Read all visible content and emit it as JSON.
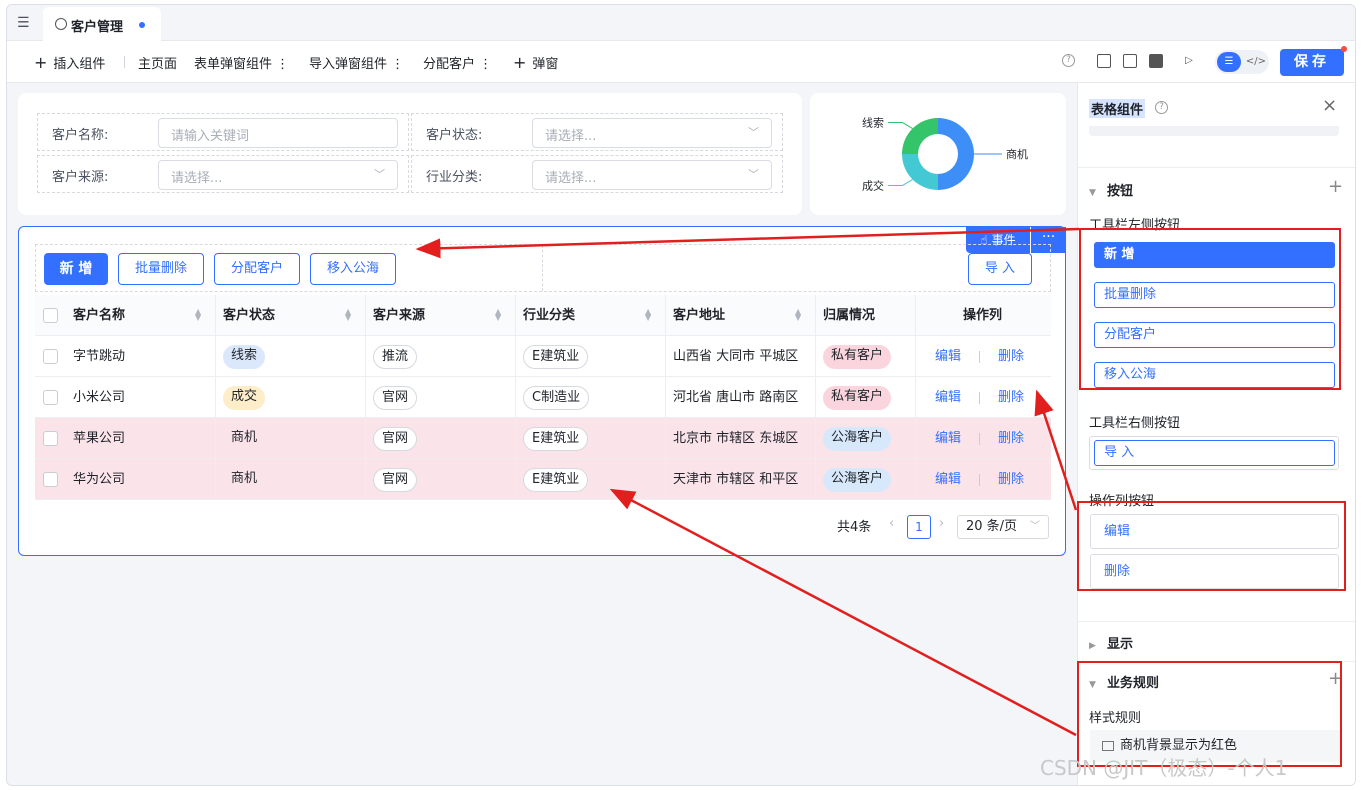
{
  "tabbar": {
    "tab_label": "客户管理"
  },
  "toolbar": {
    "insert_component": "插入组件",
    "home_page": "主页面",
    "form_popup": "表单弹窗组件",
    "import_popup": "导入弹窗组件",
    "assign_customer": "分配客户",
    "popup": "弹窗",
    "save": "保存",
    "more_glyph": "⋮",
    "plus_glyph": "+"
  },
  "filters": [
    {
      "label": "客户名称:",
      "placeholder": "请输入关键词",
      "type": "text"
    },
    {
      "label": "客户状态:",
      "placeholder": "请选择...",
      "type": "select"
    },
    {
      "label": "客户来源:",
      "placeholder": "请选择...",
      "type": "select"
    },
    {
      "label": "行业分类:",
      "placeholder": "请选择...",
      "type": "select"
    }
  ],
  "chart_data": {
    "type": "pie",
    "labels": [
      "商机",
      "成交",
      "线索"
    ],
    "values": [
      2,
      1,
      1
    ],
    "colors": [
      "#3d8ef6",
      "#43c9d4",
      "#34c46a"
    ]
  },
  "table_toolbar": {
    "add": "新 增",
    "batch_delete": "批量删除",
    "assign": "分配客户",
    "move_public": "移入公海",
    "import": "导 入",
    "event": "事件",
    "more": "···"
  },
  "table": {
    "columns": [
      "客户名称",
      "客户状态",
      "客户来源",
      "行业分类",
      "客户地址",
      "归属情况",
      "操作列"
    ],
    "rows": [
      {
        "name": "字节跳动",
        "status": "线索",
        "source": "推流",
        "industry": "E建筑业",
        "address": "山西省 大同市 平城区",
        "ownership": "私有客户",
        "edit": "编辑",
        "delete": "删除",
        "highlight": false,
        "status_style": "blue",
        "own_style": "pinktag"
      },
      {
        "name": "小米公司",
        "status": "成交",
        "source": "官网",
        "industry": "C制造业",
        "address": "河北省 唐山市 路南区",
        "ownership": "私有客户",
        "edit": "编辑",
        "delete": "删除",
        "highlight": false,
        "status_style": "yellow",
        "own_style": "pinktag"
      },
      {
        "name": "苹果公司",
        "status": "商机",
        "source": "官网",
        "industry": "E建筑业",
        "address": "北京市 市辖区 东城区",
        "ownership": "公海客户",
        "edit": "编辑",
        "delete": "删除",
        "highlight": true,
        "status_style": "none",
        "own_style": "sea"
      },
      {
        "name": "华为公司",
        "status": "商机",
        "source": "官网",
        "industry": "E建筑业",
        "address": "天津市 市辖区 和平区",
        "ownership": "公海客户",
        "edit": "编辑",
        "delete": "删除",
        "highlight": true,
        "status_style": "none",
        "own_style": "sea"
      }
    ]
  },
  "pagination": {
    "total": "共4条",
    "page": "1",
    "page_size": "20 条/页",
    "prev_glyph": "‹",
    "next_glyph": "›"
  },
  "panel": {
    "title": "表格组件",
    "close_glyph": "×",
    "help_glyph": "?",
    "section_buttons": "按钮",
    "toolbar_left": "工具栏左侧按钮",
    "left_buttons": [
      "新 增",
      "批量删除",
      "分配客户",
      "移入公海"
    ],
    "toolbar_right": "工具栏右侧按钮",
    "right_buttons": [
      "导 入"
    ],
    "op_col": "操作列按钮",
    "op_buttons": [
      "编辑",
      "删除"
    ],
    "section_display": "显示",
    "section_rules": "业务规则",
    "style_rules": "样式规则",
    "rule_item": "商机背景显示为红色",
    "plus_glyph": "+"
  },
  "watermark": "CSDN @JIT（极态）-个人1"
}
